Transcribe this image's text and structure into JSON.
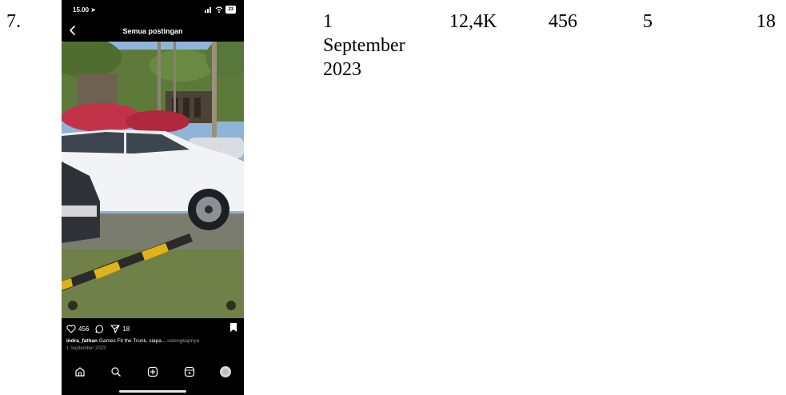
{
  "row": {
    "number": "7.",
    "date_line1": "1",
    "date_line2": "September",
    "date_line3": "2023",
    "views": "12,4K",
    "likes": "456",
    "comments": "5",
    "shares": "18"
  },
  "phone": {
    "status_time": "15.00",
    "battery": "23",
    "nav_title": "Semua postingan",
    "likes_count": "456",
    "shares_count": "18",
    "caption_user": "indra_fathan",
    "caption_text": " Games Fit the Trunk, siapa...",
    "caption_more": " selengkapnya",
    "post_date": "1 September 2023",
    "icons": [
      "back-icon",
      "heart-icon",
      "comment-icon",
      "share-icon",
      "bookmark-icon",
      "home-icon",
      "search-icon",
      "create-icon",
      "reels-icon",
      "profile-avatar"
    ]
  }
}
